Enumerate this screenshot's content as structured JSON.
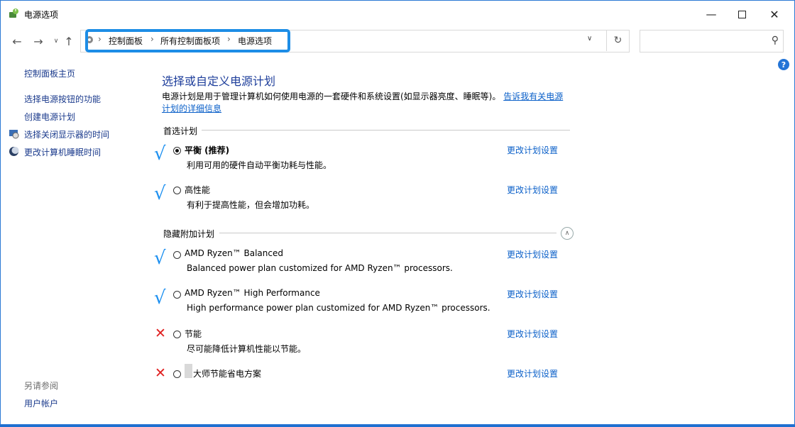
{
  "window": {
    "title": "电源选项"
  },
  "address": {
    "crumbs": [
      "控制面板",
      "所有控制面板项",
      "电源选项"
    ],
    "search_placeholder": ""
  },
  "sidebar": {
    "home": "控制面板主页",
    "links": [
      "选择电源按钮的功能",
      "创建电源计划",
      "选择关闭显示器的时间",
      "更改计算机睡眠时间"
    ],
    "see_also": "另请参阅",
    "user_accounts": "用户帐户"
  },
  "main": {
    "heading": "选择或自定义电源计划",
    "description": "电源计划是用于管理计算机如何使用电源的一套硬件和系统设置(如显示器亮度、睡眠等)。",
    "description_link": "告诉我有关电源计划的详细信息",
    "preferred_label": "首选计划",
    "hidden_label": "隐藏附加计划",
    "change_link": "更改计划设置",
    "plans": [
      {
        "name": "平衡 (推荐)",
        "desc": "利用可用的硬件自动平衡功耗与性能。",
        "selected": true,
        "mark": "check"
      },
      {
        "name": "高性能",
        "desc": "有利于提高性能，但会增加功耗。",
        "selected": false,
        "mark": "check"
      },
      {
        "name": "AMD Ryzen™ Balanced",
        "desc": "Balanced power plan customized for AMD Ryzen™ processors.",
        "selected": false,
        "mark": "check"
      },
      {
        "name": "AMD Ryzen™ High Performance",
        "desc": "High performance power plan customized for AMD Ryzen™ processors.",
        "selected": false,
        "mark": "check"
      },
      {
        "name": "节能",
        "desc": "尽可能降低计算机性能以节能。",
        "selected": false,
        "mark": "cross"
      },
      {
        "name": "大师节能省电方案",
        "desc": "",
        "selected": false,
        "mark": "cross"
      }
    ]
  },
  "colors": {
    "accent": "#1d8de6",
    "link": "#0b60c9",
    "check": "#1b8ff0",
    "cross": "#e02020"
  }
}
